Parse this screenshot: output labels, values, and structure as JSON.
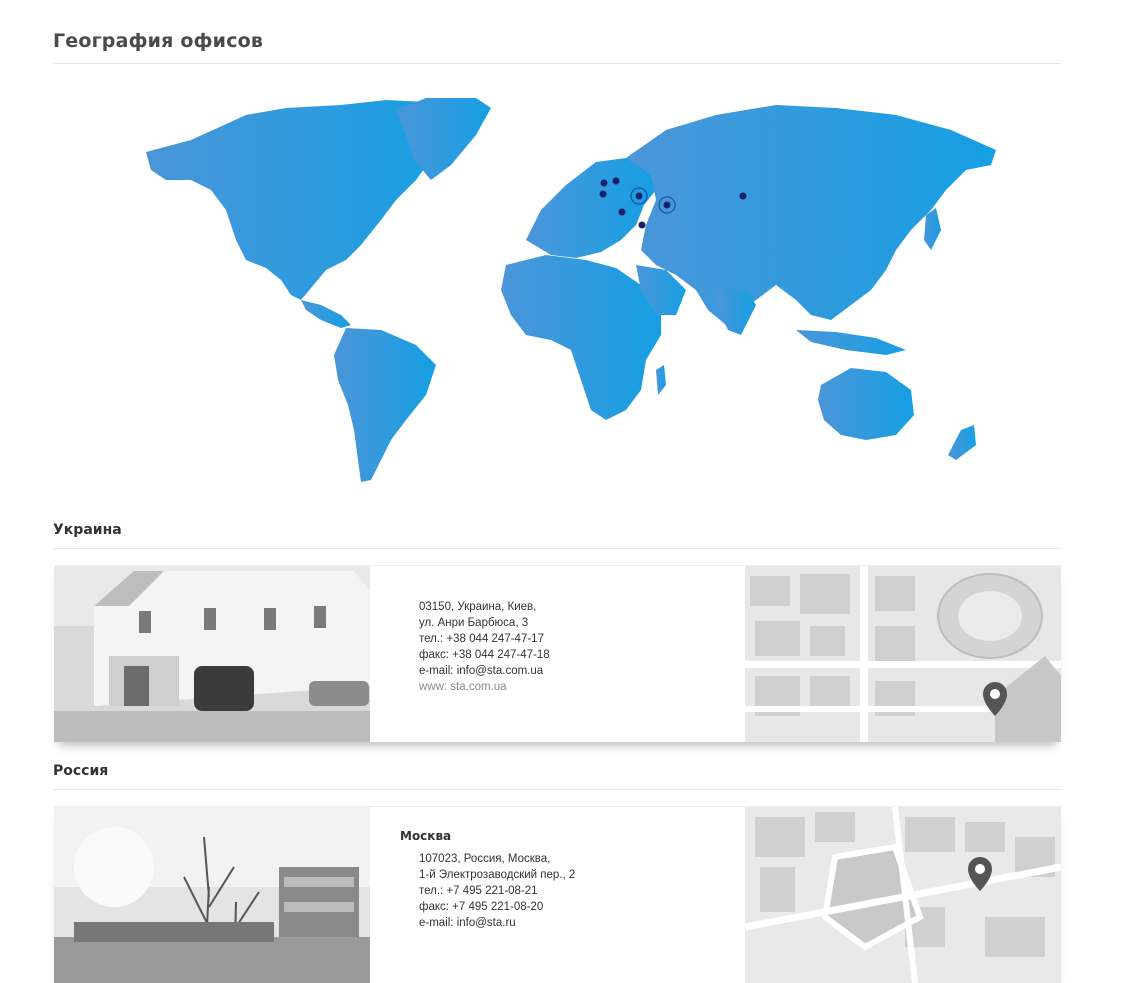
{
  "page": {
    "title": "География офисов"
  },
  "map": {
    "land_color_west": "#4b96d8",
    "land_color_east": "#159fe3",
    "marker_color": "#1a1f6e"
  },
  "sections": [
    {
      "title": "Украина",
      "address_lines": [
        "03150, Украина, Киев,",
        "ул. Анри Барбюса, 3",
        "тел.: +38 044 247-47-17",
        "факс: +38 044 247-47-18",
        "e-mail: info@sta.com.ua"
      ],
      "web_line": "www: sta.com.ua"
    },
    {
      "title": "Россия",
      "city": "Москва",
      "address_lines": [
        "107023, Россия, Москва,",
        "1-й Электрозаводский пер., 2",
        "тел.: +7 495 221-08-21",
        "факс: +7 495 221-08-20",
        "e-mail: info@sta.ru"
      ]
    }
  ]
}
